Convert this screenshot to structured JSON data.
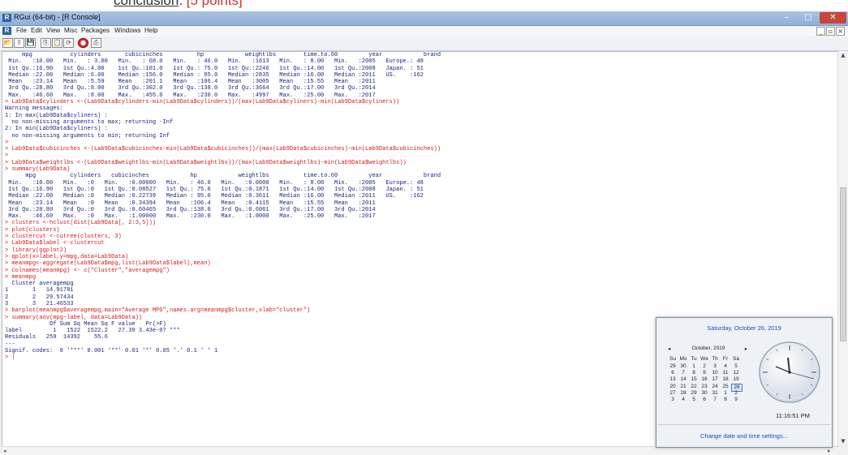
{
  "doc_heading": {
    "text": "conclusion",
    "suffix": ". ",
    "points": "[5 points]"
  },
  "window": {
    "title": "RGui (64-bit) - [R Console]",
    "app_icon": "R"
  },
  "window_buttons": {
    "minimize": "–",
    "maximize": "▢",
    "close": "✕"
  },
  "menu": {
    "items": [
      "File",
      "Edit",
      "View",
      "Misc",
      "Packages",
      "Windows",
      "Help"
    ]
  },
  "mdi_buttons": [
    "_",
    "▫",
    "×"
  ],
  "toolbar": {
    "buttons": [
      {
        "icon": "open-script-icon",
        "glyph": "📂"
      },
      {
        "icon": "load-workspace-icon",
        "glyph": "⇪"
      },
      {
        "icon": "save-workspace-icon",
        "glyph": "💾"
      },
      {
        "icon": "copy-icon",
        "glyph": "⎘"
      },
      {
        "icon": "paste-icon",
        "glyph": "📋"
      },
      {
        "icon": "copy-paste-icon",
        "glyph": "⟳"
      },
      {
        "icon": "stop-icon",
        "glyph": "●"
      },
      {
        "icon": "print-icon",
        "glyph": "⎙"
      }
    ]
  },
  "console_lines": [
    {
      "t": "     mpg           cylinders       cubicinches          hp            weightlbs        time.to.60         year            brand   ",
      "c": false
    },
    {
      "t": " Min.   :10.00   Min.   : 3.00   Min.   : 68.0   Min.   : 46.0   Min.   :1613   Min.   : 8.00   Min.   :2005   Europe.: 48  ",
      "c": false
    },
    {
      "t": " 1st Qu.:16.90   1st Qu.:4.00    1st Qu.:101.0   1st Qu.: 75.0   1st Qu.:2246   1st Qu.:14.00   1st Qu.:2008   Japan. : 51  ",
      "c": false
    },
    {
      "t": " Median :22.00   Median :6.00    Median :156.0   Median : 95.0   Median :2835   Median :16.00   Median :2011   US.    :162  ",
      "c": false
    },
    {
      "t": " Mean   :23.14   Mean   :5.59    Mean   :201.1   Mean   :106.4   Mean   :3005   Mean   :15.55   Mean   :2011                ",
      "c": false
    },
    {
      "t": " 3rd Qu.:28.80   3rd Qu.:8.00    3rd Qu.:302.0   3rd Qu.:138.0   3rd Qu.:3664   3rd Qu.:17.00   3rd Qu.:2014                ",
      "c": false
    },
    {
      "t": " Max.   :46.60   Max.   :8.00    Max.   :455.0   Max.   :230.0   Max.   :4997   Max.   :25.00   Max.   :2017                ",
      "c": false
    },
    {
      "t": "> Lab9Data$cylinders <-(Lab9Data$cylinders-min(Lab9Data$cylinders))/(max(Lab9Data$cyliners)-min(Lab9Data$cyliners))",
      "c": true
    },
    {
      "t": "Warning messages:",
      "c": false
    },
    {
      "t": "1: In max(Lab9Data$cyliners) :",
      "c": false
    },
    {
      "t": "  no non-missing arguments to max; returning -Inf",
      "c": false
    },
    {
      "t": "2: In min(Lab9Data$cyliners) :",
      "c": false
    },
    {
      "t": "  no non-missing arguments to min; returning Inf",
      "c": false
    },
    {
      "t": "> ",
      "c": true
    },
    {
      "t": "> Lab9Data$cubicinches <-(Lab9Data$cubicinches-min(Lab9Data$cubicinches))/(max(Lab9Data$cubicinches)-min(Lab9Data$cubicinches))",
      "c": true
    },
    {
      "t": "> ",
      "c": true
    },
    {
      "t": "> Lab9Data$weightlbs <-(Lab9Data$weightlbs-min(Lab9Data$weightlbs))/(max(Lab9Data$weightlbs)-min(Lab9Data$weightlbs))",
      "c": true
    },
    {
      "t": "> summary(Lab9Data)",
      "c": true
    },
    {
      "t": "      mpg          cylinders   cubicinches            hp            weightlbs          time.to.60         year            brand    ",
      "c": false
    },
    {
      "t": " Min.   :10.00   Min.   :0   Min.   :0.00000   Min.   : 46.0   Min.   :0.0000   Min.   : 8.00   Min.   :2005   Europe.: 48  ",
      "c": false
    },
    {
      "t": " 1st Qu.:16.90   1st Qu.:0   1st Qu.:0.08527   1st Qu.: 75.0   1st Qu.:0.1871   1st Qu.:14.00   1st Qu.:2008   Japan. : 51  ",
      "c": false
    },
    {
      "t": " Median :22.00   Median :0   Median :0.22739   Median : 95.0   Median :0.3611   Median :16.00   Median :2011   US.    :162  ",
      "c": false
    },
    {
      "t": " Mean   :23.14   Mean   :0   Mean   :0.34394   Mean   :106.4   Mean   :0.4115   Mean   :15.55   Mean   :2011                ",
      "c": false
    },
    {
      "t": " 3rd Qu.:28.80   3rd Qu.:0   3rd Qu.:0.60465   3rd Qu.:138.0   3rd Qu.:0.6061   3rd Qu.:17.00   3rd Qu.:2014                ",
      "c": false
    },
    {
      "t": " Max.   :46.60   Max.   :0   Max.   :1.00000   Max.   :230.0   Max.   :1.0000   Max.   :25.00   Max.   :2017                ",
      "c": false
    },
    {
      "t": "> clusters <-hclust(dist(Lab9Data[, 2:3,5]))",
      "c": true
    },
    {
      "t": "> plot(clusters)",
      "c": true
    },
    {
      "t": "> clustercut <-cutree(clusters, 3)",
      "c": true
    },
    {
      "t": "> Lab9Data$label <-clustercut",
      "c": true
    },
    {
      "t": "> library(ggplot2)",
      "c": true
    },
    {
      "t": "> qplot(x=label,y=mpg,data=Lab9Data)",
      "c": true
    },
    {
      "t": "> meanmpg<-aggregate(Lab9Data$mpg,list(Lab9Data$label),mean)",
      "c": true
    },
    {
      "t": "> colnames(meanmpg) <- c(\"Cluster\",\"averagempg\")",
      "c": true
    },
    {
      "t": "> meanmpg",
      "c": true
    },
    {
      "t": "  Cluster averagempg",
      "c": false
    },
    {
      "t": "1       1   14.91781",
      "c": false
    },
    {
      "t": "2       2   29.57434",
      "c": false
    },
    {
      "t": "3       3   21.46533",
      "c": false
    },
    {
      "t": "> barplot(meanmpg$averagempg,main=\"Average MPG\",names.arg=meanmpg$cluster,xlab=\"cluster\")",
      "c": true
    },
    {
      "t": "> summary(aov(mpg~label, data=Lab9Data))",
      "c": true
    },
    {
      "t": "             Df Sum Sq Mean Sq F value   Pr(>F)    ",
      "c": false
    },
    {
      "t": "label         1   1522  1522.2   27.39 3.43e-07 ***",
      "c": false
    },
    {
      "t": "Residuals   259  14392    55.6                     ",
      "c": false
    },
    {
      "t": "---",
      "c": false
    },
    {
      "t": "Signif. codes:  0 '***' 0.001 '**' 0.01 '*' 0.05 '.' 0.1 ' ' 1",
      "c": false
    },
    {
      "t": "> |",
      "c": true
    }
  ],
  "scroll": {
    "up": "▲",
    "down": "▼",
    "left": "◂",
    "right": "▸"
  },
  "datetime_popup": {
    "header": "Saturday, October 26, 2019",
    "prev": "◂",
    "next": "▸",
    "month": "October, 2019",
    "weekdays": [
      "Su",
      "Mo",
      "Tu",
      "We",
      "Th",
      "Fr",
      "Sa"
    ],
    "weeks": [
      [
        "29",
        "30",
        "1",
        "2",
        "3",
        "4",
        "5"
      ],
      [
        "6",
        "7",
        "8",
        "9",
        "10",
        "11",
        "12"
      ],
      [
        "13",
        "14",
        "15",
        "16",
        "17",
        "18",
        "19"
      ],
      [
        "20",
        "21",
        "22",
        "23",
        "24",
        "25",
        "26"
      ],
      [
        "27",
        "28",
        "29",
        "30",
        "31",
        "1",
        "2"
      ],
      [
        "3",
        "4",
        "5",
        "6",
        "7",
        "8",
        "9"
      ]
    ],
    "today": "26",
    "time": "11:16:51 PM",
    "link": "Change date and time settings..."
  }
}
